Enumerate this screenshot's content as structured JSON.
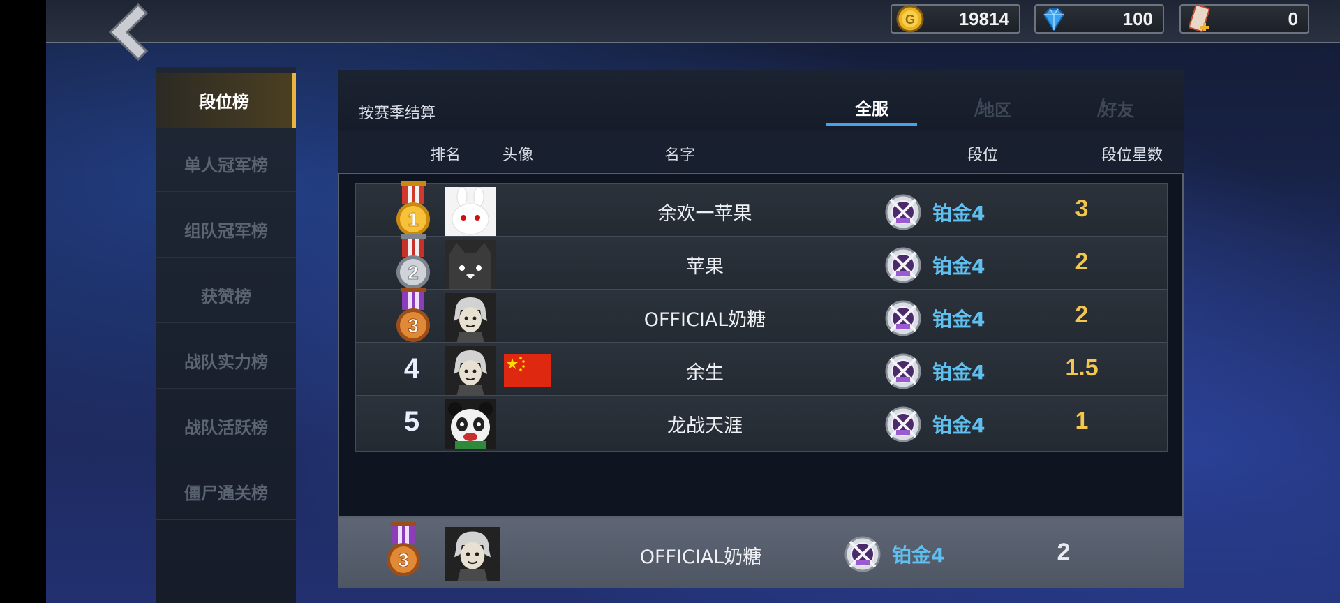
{
  "header": {
    "currencies": [
      {
        "name": "gold-coin-icon",
        "value": "19814"
      },
      {
        "name": "diamond-icon",
        "value": "100"
      },
      {
        "name": "ticket-icon",
        "value": "0"
      }
    ]
  },
  "sidebar": {
    "items": [
      {
        "label": "段位榜",
        "active": true
      },
      {
        "label": "单人冠军榜",
        "active": false
      },
      {
        "label": "组队冠军榜",
        "active": false
      },
      {
        "label": "获赞榜",
        "active": false
      },
      {
        "label": "战队实力榜",
        "active": false
      },
      {
        "label": "战队活跃榜",
        "active": false
      },
      {
        "label": "僵尸通关榜",
        "active": false
      }
    ]
  },
  "panel": {
    "settle_label": "按赛季结算",
    "tabs": [
      {
        "label": "全服",
        "active": true
      },
      {
        "label": "地区",
        "active": false
      },
      {
        "label": "好友",
        "active": false
      }
    ],
    "separator": "/",
    "columns": {
      "rank": "排名",
      "avatar": "头像",
      "name": "名字",
      "tier": "段位",
      "stars": "段位星数"
    }
  },
  "rows": [
    {
      "rank": "1",
      "medal": "gold",
      "avatar": "rabbit-avatar",
      "flag": false,
      "name": "余欢一苹果",
      "tier": "铂金4",
      "stars": "3"
    },
    {
      "rank": "2",
      "medal": "silver",
      "avatar": "cat-avatar",
      "flag": false,
      "name": "苹果",
      "tier": "铂金4",
      "stars": "2"
    },
    {
      "rank": "3",
      "medal": "bronze",
      "avatar": "boy-avatar",
      "flag": false,
      "name": "OFFICIAL奶糖",
      "tier": "铂金4",
      "stars": "2"
    },
    {
      "rank": "4",
      "medal": "",
      "avatar": "boy-avatar",
      "flag": true,
      "name": "余生",
      "tier": "铂金4",
      "stars": "1.5"
    },
    {
      "rank": "5",
      "medal": "",
      "avatar": "panda-avatar",
      "flag": false,
      "name": "龙战天涯",
      "tier": "铂金4",
      "stars": "1"
    }
  ],
  "my_row": {
    "rank": "3",
    "medal": "bronze",
    "avatar": "boy-avatar",
    "name": "OFFICIAL奶糖",
    "tier": "铂金4",
    "stars": "2"
  },
  "colors": {
    "accent_gold": "#e8b640",
    "tab_underline": "#4aa0e8",
    "tier_text": "#5fc0f0",
    "stars_text": "#f3c74e"
  }
}
